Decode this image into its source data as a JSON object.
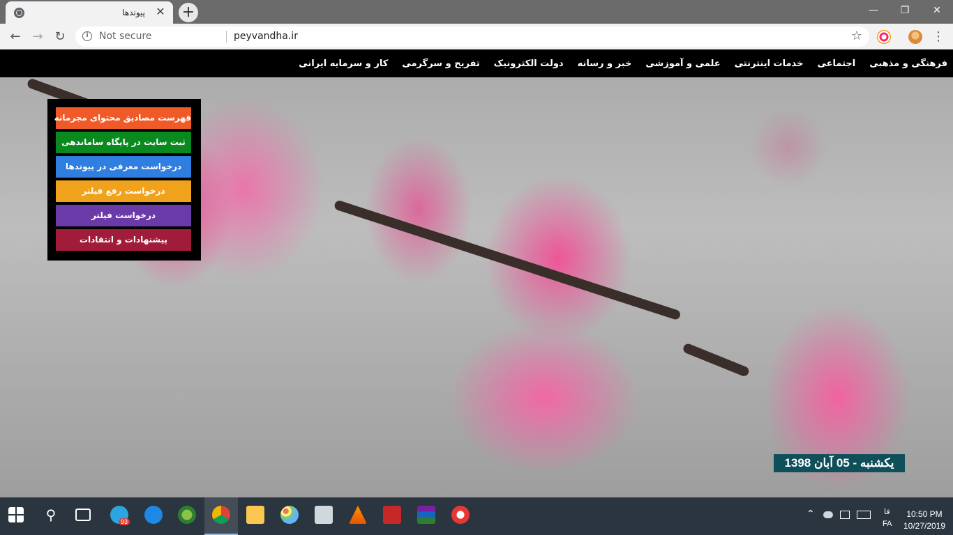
{
  "browser": {
    "tab_title": "پیوندها",
    "tab_close": "✕",
    "new_tab": "+",
    "window_controls": {
      "minimize": "—",
      "restore": "❐",
      "close": "✕"
    },
    "nav": {
      "back": "←",
      "forward": "→",
      "reload": "↻"
    },
    "security_label": "Not secure",
    "url": "peyvandha.ir",
    "bookmark_star": "☆",
    "menu": "⋮"
  },
  "topnav": {
    "items": [
      "فرهنگی و مذهبی",
      "اجتماعی",
      "خدمات اینترنتی",
      "علمی و آموزشی",
      "خبر و رسانه",
      "دولت الکترونیک",
      "تفریح و سرگرمی",
      "کار و سرمایه ایرانی"
    ]
  },
  "sidepanel": {
    "buttons": [
      {
        "label": "فهرست مصادیق محتوای مجرمانه",
        "color": "#f05a28"
      },
      {
        "label": "ثبت سایت در پایگاه ساماندهی",
        "color": "#0a8a1e"
      },
      {
        "label": "درخواست معرفی در پیوندها",
        "color": "#2f7fe0"
      },
      {
        "label": "درخواست رفع فیلتر",
        "color": "#f0a21c"
      },
      {
        "label": "درخواست فیلتر",
        "color": "#6a3aa8"
      },
      {
        "label": "پیشنهادات و انتقادات",
        "color": "#a01c3a"
      }
    ]
  },
  "date": "یکشنبه - 05 آبان 1398",
  "taskbar": {
    "telegram_badge": "93",
    "ime_label": "فا",
    "lang": "FA",
    "time": "10:50 PM",
    "date": "10/27/2019"
  }
}
